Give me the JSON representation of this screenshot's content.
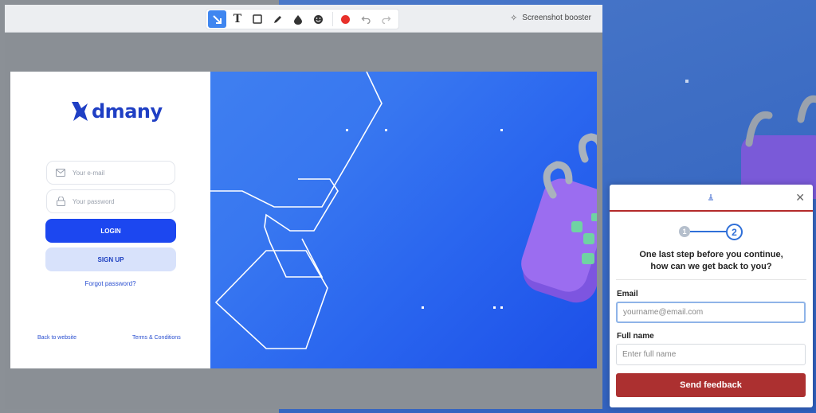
{
  "toolbar": {
    "tools": [
      {
        "name": "arrow-tool",
        "glyph": "↘"
      },
      {
        "name": "text-tool",
        "glyph": "T"
      },
      {
        "name": "rectangle-tool",
        "glyph": "▢"
      },
      {
        "name": "pencil-tool",
        "glyph": "✎"
      },
      {
        "name": "blur-tool",
        "glyph": "●"
      },
      {
        "name": "emoji-tool",
        "glyph": "☻"
      }
    ],
    "record_color": "#e8302a",
    "booster_label": "Screenshot booster"
  },
  "login": {
    "brand": "dmany",
    "brand_color": "#1f3fc4",
    "email_placeholder": "Your e-mail",
    "password_placeholder": "Your password",
    "login_label": "LOGIN",
    "signup_label": "SIGN UP",
    "forgot_label": "Forgot password?",
    "back_label": "Back to website",
    "terms_label": "Terms & Conditions"
  },
  "feedback": {
    "step1": "1",
    "step2": "2",
    "question_line1": "One last step before you continue,",
    "question_line2": "how can we get back to you?",
    "email_label": "Email",
    "email_placeholder": "yourname@email.com",
    "name_label": "Full name",
    "name_placeholder": "Enter full name",
    "send_label": "Send feedback",
    "accent_color": "#ac3030"
  }
}
